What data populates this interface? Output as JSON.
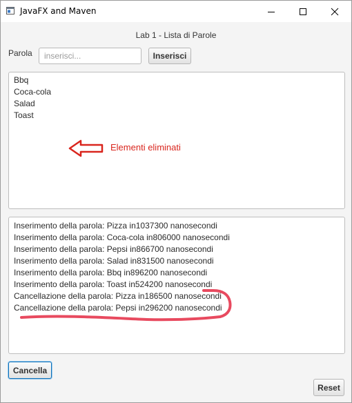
{
  "window": {
    "title": "JavaFX and Maven"
  },
  "header": {
    "title": "Lab 1 - Lista di Parole"
  },
  "form": {
    "label": "Parola",
    "input_value": "",
    "input_placeholder": "inserisci...",
    "insert_label": "Inserisci"
  },
  "words_list": {
    "items": [
      "Bbq",
      "Coca-cola",
      "Salad",
      "Toast"
    ]
  },
  "annotation": {
    "text": "Elementi eliminati",
    "color": "#d9251d"
  },
  "log_list": {
    "items": [
      "Inserimento della parola: Pizza  in1037300 nanosecondi",
      "Inserimento della parola: Coca-cola  in806000 nanosecondi",
      "Inserimento della parola: Pepsi  in866700 nanosecondi",
      "Inserimento della parola: Salad  in831500 nanosecondi",
      "Inserimento della parola: Bbq  in896200 nanosecondi",
      "Inserimento della parola: Toast  in524200 nanosecondi",
      "Cancellazione della parola: Pizza in186500 nanosecondi",
      "Cancellazione della parola: Pepsi in296200 nanosecondi"
    ]
  },
  "buttons": {
    "cancella_label": "Cancella",
    "reset_label": "Reset"
  },
  "colors": {
    "focus_border": "#0a6fb8",
    "annotation_red": "#d9251d",
    "underline_red": "#e84a5f"
  }
}
